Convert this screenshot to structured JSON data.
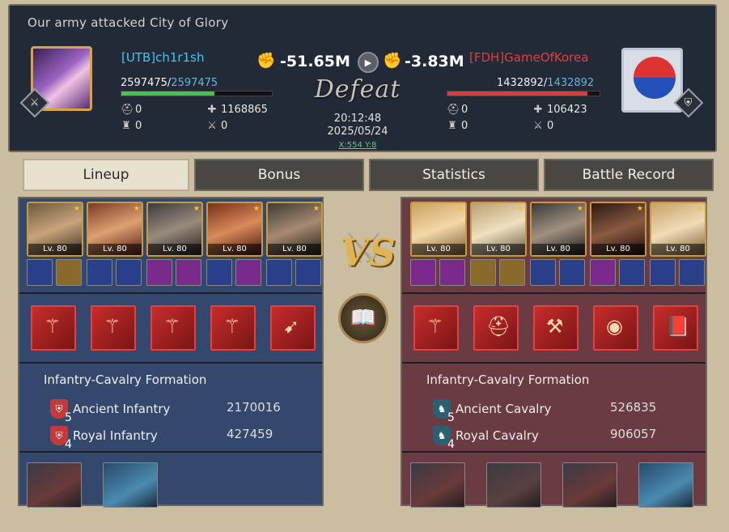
{
  "header": {
    "title": "Our army attacked City of Glory",
    "result": "Defeat",
    "time": "20:12:48",
    "date": "2025/05/24",
    "coord": "X:554 Y:8"
  },
  "left": {
    "name": "[UTB]ch1r1sh",
    "power_change": "-51.65M",
    "hp_current": "2597475",
    "hp_max": "2597475",
    "hp_fraction": 0.62,
    "stats": {
      "helmet": "0",
      "tower": "0",
      "heal": "1168865",
      "swords": "0"
    },
    "heroes": [
      {
        "level": "Lv. 80"
      },
      {
        "level": "Lv. 80"
      },
      {
        "level": "Lv. 80"
      },
      {
        "level": "Lv. 80"
      },
      {
        "level": "Lv. 80"
      }
    ],
    "formation": "Infantry-Cavalry Formation",
    "troops": [
      {
        "tier": "5",
        "name": "Ancient Infantry",
        "value": "2170016"
      },
      {
        "tier": "4",
        "name": "Royal Infantry",
        "value": "427459"
      }
    ]
  },
  "right": {
    "name": "[FDH]GameOfKorea",
    "power_change": "-3.83M",
    "hp_current": "1432892",
    "hp_max": "1432892",
    "hp_fraction": 0.92,
    "stats": {
      "helmet": "0",
      "tower": "0",
      "heal": "106423",
      "swords": "0"
    },
    "heroes": [
      {
        "level": "Lv. 80"
      },
      {
        "level": "Lv. 80"
      },
      {
        "level": "Lv. 80"
      },
      {
        "level": "Lv. 80"
      },
      {
        "level": "Lv. 80"
      }
    ],
    "formation": "Infantry-Cavalry Formation",
    "troops": [
      {
        "tier": "5",
        "name": "Ancient Cavalry",
        "value": "526835"
      },
      {
        "tier": "4",
        "name": "Royal Cavalry",
        "value": "906057"
      }
    ]
  },
  "vs_label": "VS",
  "tabs": [
    {
      "label": "Lineup",
      "active": true
    },
    {
      "label": "Bonus",
      "active": false
    },
    {
      "label": "Statistics",
      "active": false
    },
    {
      "label": "Battle Record",
      "active": false
    }
  ],
  "colors": {
    "left_panel": "#34476d",
    "right_panel": "#6a3b43",
    "hp_left": "#3cc84a",
    "hp_right": "#e23a3a"
  }
}
